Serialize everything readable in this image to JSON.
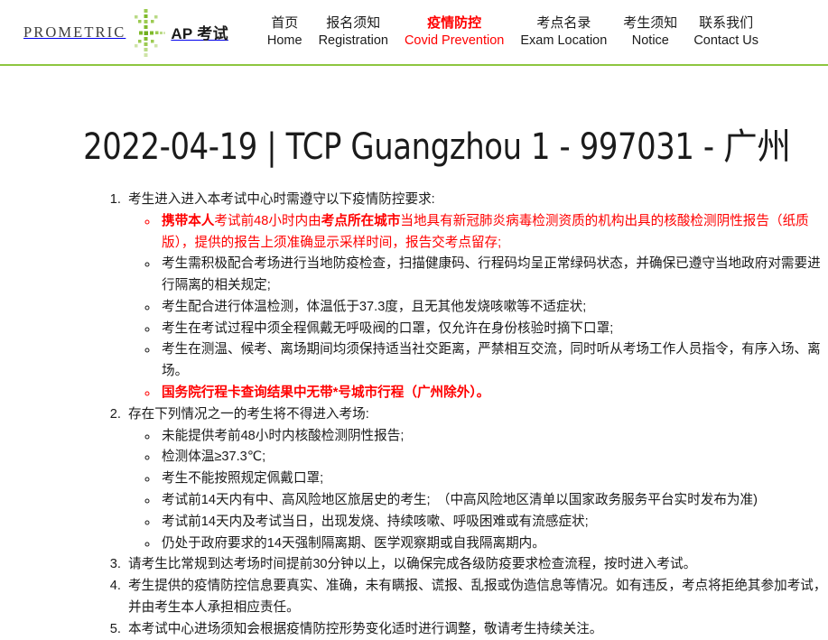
{
  "header": {
    "brand": {
      "wordmark": "PROMETRIC",
      "burst_icon": "green-starburst-dots-icon",
      "product": "AP 考试"
    },
    "nav_items": [
      {
        "zh": "首页",
        "en": "Home",
        "active": false
      },
      {
        "zh": "报名须知",
        "en": "Registration",
        "active": false
      },
      {
        "zh": "疫情防控",
        "en": "Covid Prevention",
        "active": true
      },
      {
        "zh": "考点名录",
        "en": "Exam Location",
        "active": false
      },
      {
        "zh": "考生须知",
        "en": "Notice",
        "active": false
      },
      {
        "zh": "联系我们",
        "en": "Contact Us",
        "active": false
      }
    ],
    "accent_green": "#8dc63f",
    "active_red": "#ff0000"
  },
  "main": {
    "title": "2022-04-19 | TCP Guangzhou 1 - 997031 - 广州",
    "items": {
      "i1": "考生进入进入本考试中心时需遵守以下疫情防控要求:",
      "i1s1_a": "携带本人",
      "i1s1_b": "考试前48小时内由",
      "i1s1_c": "考点所在城市",
      "i1s1_d": "当地具有新冠肺炎病毒检测资质的机构出具的核酸检测阴性报告（纸质版），提供的报告上须准确显示采样时间，报告交考点留存;",
      "i1s2": "考生需积极配合考场进行当地防疫检查，扫描健康码、行程码均呈正常绿码状态，并确保已遵守当地政府对需要进行隔离的相关规定;",
      "i1s3": "考生配合进行体温检测，体温低于37.3度，且无其他发烧咳嗽等不适症状;",
      "i1s4": "考生在考试过程中须全程佩戴无呼吸阀的口罩，仅允许在身份核验时摘下口罩;",
      "i1s5": "考生在测温、候考、离场期间均须保持适当社交距离，严禁相互交流，同时听从考场工作人员指令，有序入场、离场。",
      "i1s6": "国务院行程卡查询结果中无带*号城市行程（广州除外）。",
      "i2": "存在下列情况之一的考生将不得进入考场:",
      "i2s1": "未能提供考前48小时内核酸检测阴性报告;",
      "i2s2": "检测体温≥37.3℃;",
      "i2s3": "考生不能按照规定佩戴口罩;",
      "i2s4": "考试前14天内有中、高风险地区旅居史的考生;　（中高风险地区清单以国家政务服务平台实时发布为准)",
      "i2s5": "考试前14天内及考试当日，出现发烧、持续咳嗽、呼吸困难或有流感症状;",
      "i2s6": "仍处于政府要求的14天强制隔离期、医学观察期或自我隔离期内。",
      "i3": "请考生比常规到达考场时间提前30分钟以上，以确保完成各级防疫要求检查流程，按时进入考试。",
      "i4": "考生提供的疫情防控信息要真实、准确，未有瞒报、谎报、乱报或伪造信息等情况。如有违反，考点将拒绝其参加考试，并由考生本人承担相应责任。",
      "i5": "本考试中心进场须知会根据疫情防控形势变化适时进行调整，敬请考生持续关注。"
    }
  }
}
